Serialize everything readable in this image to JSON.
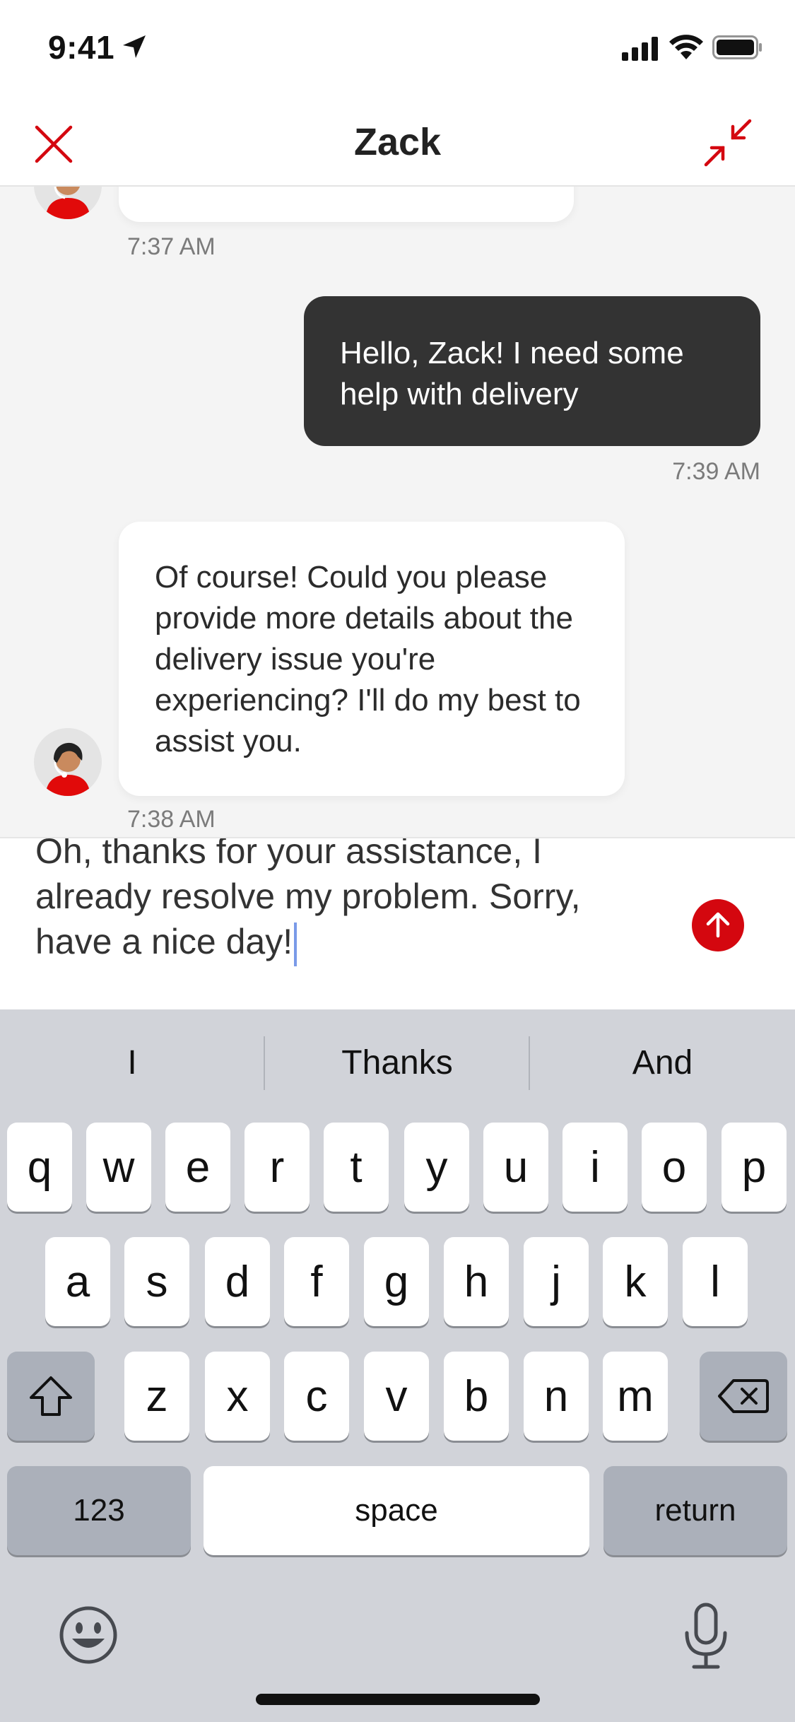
{
  "status_bar": {
    "time": "9:41",
    "icons": [
      "location-arrow-icon",
      "cellular-signal-icon",
      "wifi-icon",
      "battery-icon"
    ]
  },
  "header": {
    "title": "Zack",
    "close_icon": "close-icon",
    "minimize_icon": "minimize-icon",
    "accent_color": "#d4070f"
  },
  "chat": {
    "messages": [
      {
        "from": "agent",
        "text": "",
        "time": "7:37 AM"
      },
      {
        "from": "user",
        "text": "Hello, Zack! I need some help with delivery",
        "time": "7:39 AM"
      },
      {
        "from": "agent",
        "text": "Of course! Could you please provide more details about the delivery issue you're experiencing? I'll do my best to assist you.",
        "time": "7:38 AM"
      }
    ]
  },
  "composer": {
    "draft": "Oh, thanks for your assistance, I already resolve my problem. Sorry, have a nice day!",
    "send_icon": "send-arrow-up-icon"
  },
  "keyboard": {
    "suggestions": [
      "I",
      "Thanks",
      "And"
    ],
    "row1": [
      "q",
      "w",
      "e",
      "r",
      "t",
      "y",
      "u",
      "i",
      "o",
      "p"
    ],
    "row2": [
      "a",
      "s",
      "d",
      "f",
      "g",
      "h",
      "j",
      "k",
      "l"
    ],
    "row3": [
      "z",
      "x",
      "c",
      "v",
      "b",
      "n",
      "m"
    ],
    "numbers_label": "123",
    "space_label": "space",
    "return_label": "return",
    "shift_icon": "shift-icon",
    "delete_icon": "delete-backspace-icon",
    "emoji_icon": "emoji-icon",
    "mic_icon": "microphone-icon"
  }
}
